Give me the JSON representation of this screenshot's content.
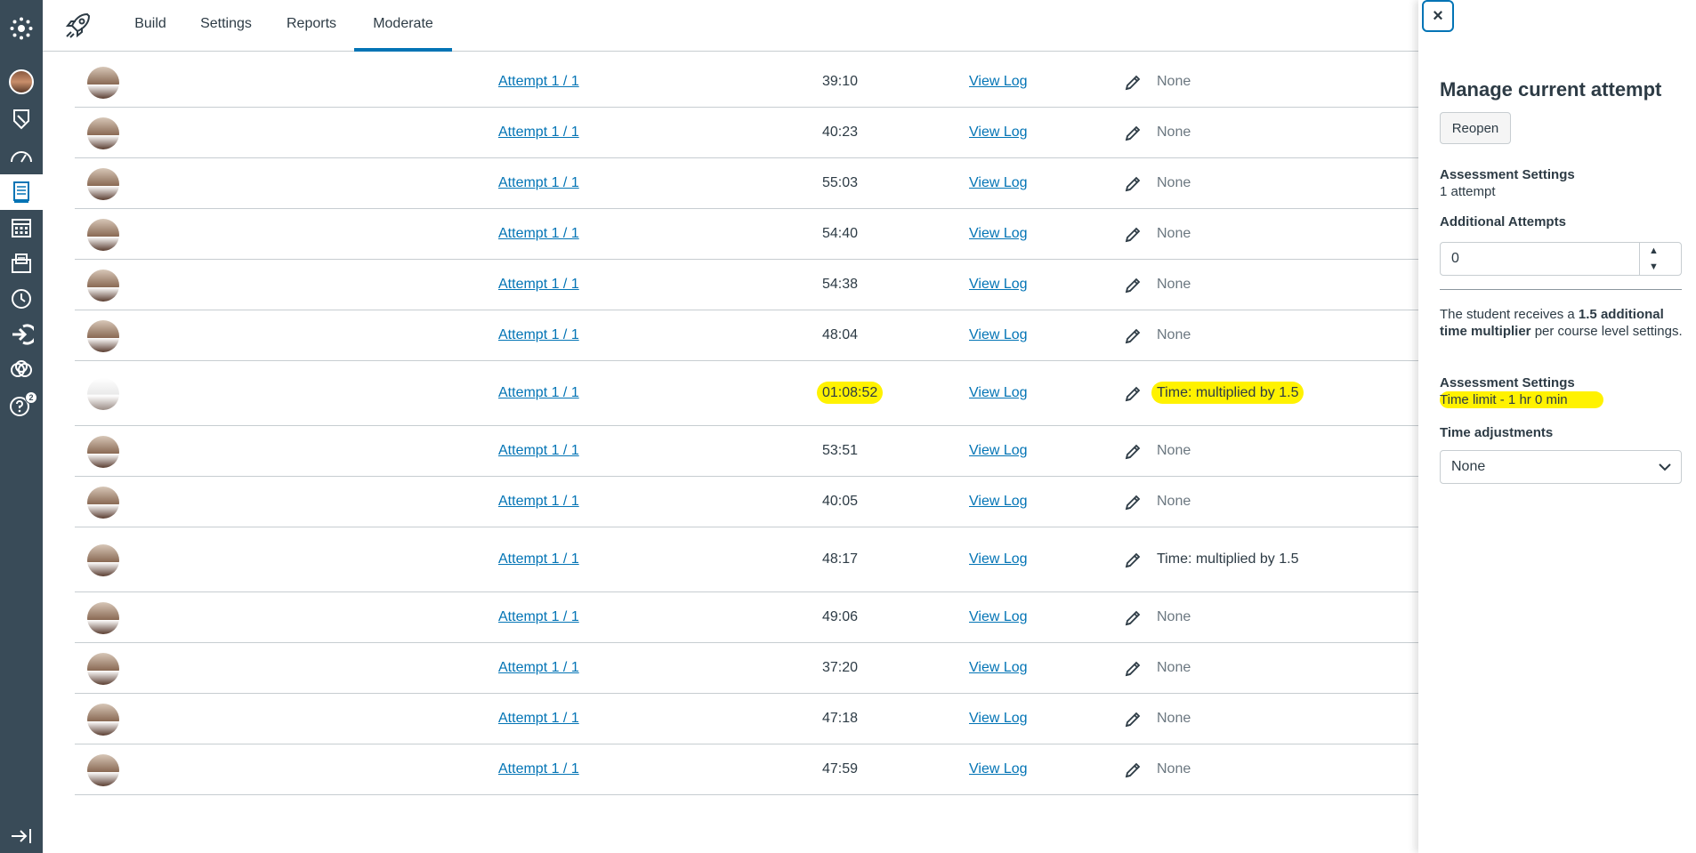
{
  "nav": {
    "items": [
      {
        "name": "canvas-logo-icon"
      },
      {
        "name": "account-avatar"
      },
      {
        "name": "admin-shield-icon"
      },
      {
        "name": "dashboard-icon"
      },
      {
        "name": "courses-icon"
      },
      {
        "name": "calendar-icon"
      },
      {
        "name": "inbox-icon"
      },
      {
        "name": "history-icon"
      },
      {
        "name": "commons-icon"
      },
      {
        "name": "studio-icon"
      },
      {
        "name": "help-icon",
        "badge": "2"
      }
    ]
  },
  "tabs": [
    {
      "label": "Build",
      "active": false
    },
    {
      "label": "Settings",
      "active": false
    },
    {
      "label": "Reports",
      "active": false
    },
    {
      "label": "Moderate",
      "active": true
    }
  ],
  "rows": [
    {
      "attempt": "Attempt 1 / 1",
      "duration": "39:10",
      "log": "View Log",
      "accommodation": "None"
    },
    {
      "attempt": "Attempt 1 / 1",
      "duration": "40:23",
      "log": "View Log",
      "accommodation": "None"
    },
    {
      "attempt": "Attempt 1 / 1",
      "duration": "55:03",
      "log": "View Log",
      "accommodation": "None"
    },
    {
      "attempt": "Attempt 1 / 1",
      "duration": "54:40",
      "log": "View Log",
      "accommodation": "None"
    },
    {
      "attempt": "Attempt 1 / 1",
      "duration": "54:38",
      "log": "View Log",
      "accommodation": "None"
    },
    {
      "attempt": "Attempt 1 / 1",
      "duration": "48:04",
      "log": "View Log",
      "accommodation": "None"
    },
    {
      "attempt": "Attempt 1 / 1",
      "duration": "01:08:52",
      "log": "View Log",
      "accommodation": "Time: multiplied by 1.5",
      "highlight": true
    },
    {
      "attempt": "Attempt 1 / 1",
      "duration": "53:51",
      "log": "View Log",
      "accommodation": "None"
    },
    {
      "attempt": "Attempt 1 / 1",
      "duration": "40:05",
      "log": "View Log",
      "accommodation": "None"
    },
    {
      "attempt": "Attempt 1 / 1",
      "duration": "48:17",
      "log": "View Log",
      "accommodation": "Time: multiplied by 1.5"
    },
    {
      "attempt": "Attempt 1 / 1",
      "duration": "49:06",
      "log": "View Log",
      "accommodation": "None"
    },
    {
      "attempt": "Attempt 1 / 1",
      "duration": "37:20",
      "log": "View Log",
      "accommodation": "None"
    },
    {
      "attempt": "Attempt 1 / 1",
      "duration": "47:18",
      "log": "View Log",
      "accommodation": "None"
    },
    {
      "attempt": "Attempt 1 / 1",
      "duration": "47:59",
      "log": "View Log",
      "accommodation": "None"
    }
  ],
  "tray": {
    "close_label": "×",
    "title": "Manage current attempt",
    "reopen_label": "Reopen",
    "assessment_settings_label": "Assessment Settings",
    "attempts_text": "1 attempt",
    "additional_attempts_label": "Additional Attempts",
    "additional_attempts_value": "0",
    "note_prefix": "The student receives a ",
    "note_bold": "1.5 additional time multiplier",
    "note_suffix": " per course level settings.",
    "assessment_settings_label_2": "Assessment Settings",
    "time_limit_text": "Time limit - 1 hr 0 min",
    "time_adjustments_label": "Time adjustments",
    "time_adjustments_value": "None"
  },
  "colors": {
    "nav_bg": "#394b58",
    "link": "#0374b5",
    "highlight": "#fff200",
    "text": "#2d3b45"
  }
}
